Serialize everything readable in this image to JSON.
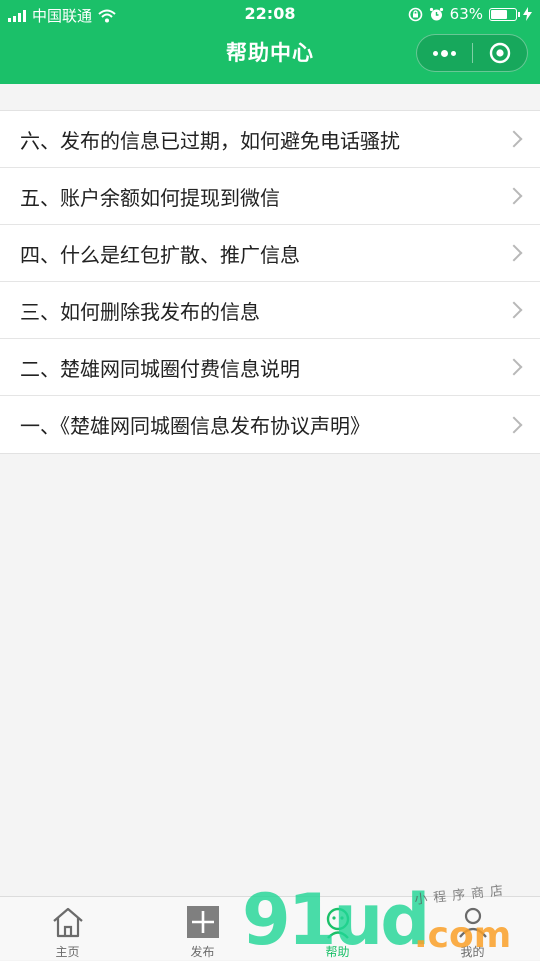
{
  "status_bar": {
    "carrier": "中国联通",
    "time": "22:08",
    "battery_percent": "63%",
    "battery_level": 0.63
  },
  "nav": {
    "title": "帮助中心"
  },
  "help_items": [
    {
      "label": "六、发布的信息已过期，如何避免电话骚扰"
    },
    {
      "label": "五、账户余额如何提现到微信"
    },
    {
      "label": "四、什么是红包扩散、推广信息"
    },
    {
      "label": "三、如何删除我发布的信息"
    },
    {
      "label": "二、楚雄网同城圈付费信息说明"
    },
    {
      "label": "一、《楚雄网同城圈信息发布协议声明》"
    }
  ],
  "tabbar": {
    "tabs": [
      {
        "label": "主页",
        "icon": "home-icon"
      },
      {
        "label": "发布",
        "icon": "plus-square-icon"
      },
      {
        "label": "帮助",
        "icon": "help-person-icon",
        "active": true
      },
      {
        "label": "我的",
        "icon": "user-icon"
      }
    ]
  },
  "watermark": {
    "brand": "91ud",
    "suffix": ".com",
    "tagline": "小程序商店"
  },
  "colors": {
    "primary": "#1bc069",
    "background": "#f4f4f4",
    "text": "#222222"
  }
}
